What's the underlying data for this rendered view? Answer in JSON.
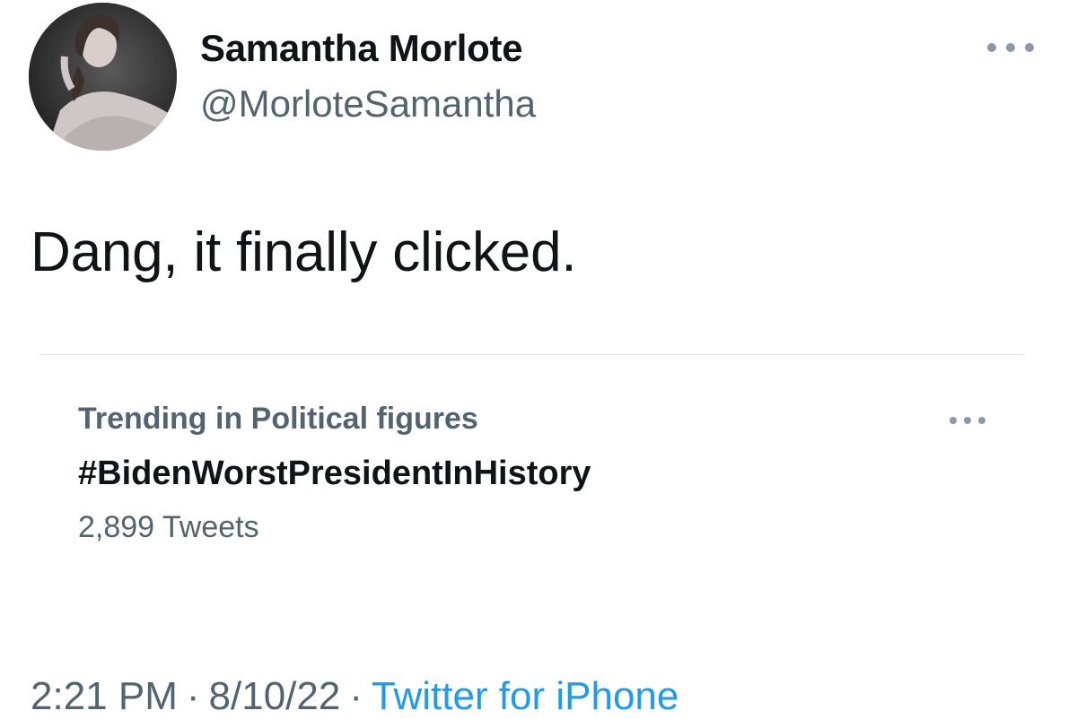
{
  "author": {
    "display_name": "Samantha Morlote",
    "handle": "@MorloteSamantha",
    "avatar_icon": "profile-photo"
  },
  "tweet": {
    "text": "Dang, it finally clicked."
  },
  "trend": {
    "category": "Trending in Political figures",
    "name": "#BidenWorstPresidentInHistory",
    "count": "2,899 Tweets"
  },
  "meta": {
    "time": "2:21 PM",
    "separator": "·",
    "date": "8/10/22",
    "source": "Twitter for iPhone"
  },
  "colors": {
    "primary_text": "#0f1419",
    "secondary_text": "#536471",
    "link": "#1d9bf0",
    "divider": "#dfe3e6"
  }
}
